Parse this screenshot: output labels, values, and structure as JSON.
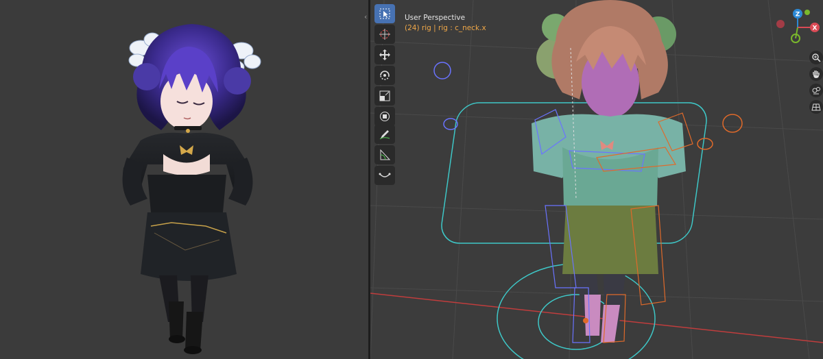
{
  "header": {
    "view_name": "User Perspective",
    "active_object": "(24) rig | rig : c_neck.x"
  },
  "toolbar": {
    "tools": [
      {
        "name": "select-box",
        "active": true
      },
      {
        "name": "cursor",
        "active": false
      },
      {
        "name": "move",
        "active": false
      },
      {
        "name": "rotate",
        "active": false
      },
      {
        "name": "scale",
        "active": false
      },
      {
        "name": "transform",
        "active": false
      },
      {
        "name": "annotate",
        "active": false
      },
      {
        "name": "measure",
        "active": false
      },
      {
        "name": "curve",
        "active": false
      }
    ]
  },
  "gizmo": {
    "axis_z": "Z",
    "axis_y": "Y",
    "axis_x": "X",
    "colors": {
      "x": "#d94a55",
      "y": "#7ab82c",
      "z": "#2c89d6"
    }
  },
  "nav_buttons": [
    "zoom-icon",
    "pan-hand-icon",
    "camera-view-icon",
    "grid-toggle-icon"
  ],
  "colors": {
    "viewport_bg": "#3c3c3c",
    "grid_line": "#505050",
    "x_axis": "#c13d3d",
    "armature_blue": "#6a73ff",
    "armature_cyan": "#3ec8c8",
    "armature_orange": "#e06a2a",
    "active_tool": "#4772b3",
    "overlay_text_highlight": "#f0a848"
  }
}
